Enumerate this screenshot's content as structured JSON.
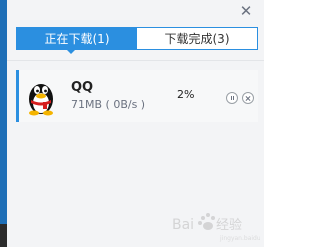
{
  "window": {
    "close_label": "✕"
  },
  "tabs": [
    {
      "label": "正在下载(1)",
      "active": true
    },
    {
      "label": "下载完成(3)",
      "active": false
    }
  ],
  "downloads": [
    {
      "name": "QQ",
      "size_speed": "71MB ( 0B/s )",
      "progress_percent": "2%",
      "icon": "qq-penguin-icon"
    }
  ],
  "colors": {
    "accent": "#2b8fe0",
    "sidebar": "#1e6fb7"
  }
}
